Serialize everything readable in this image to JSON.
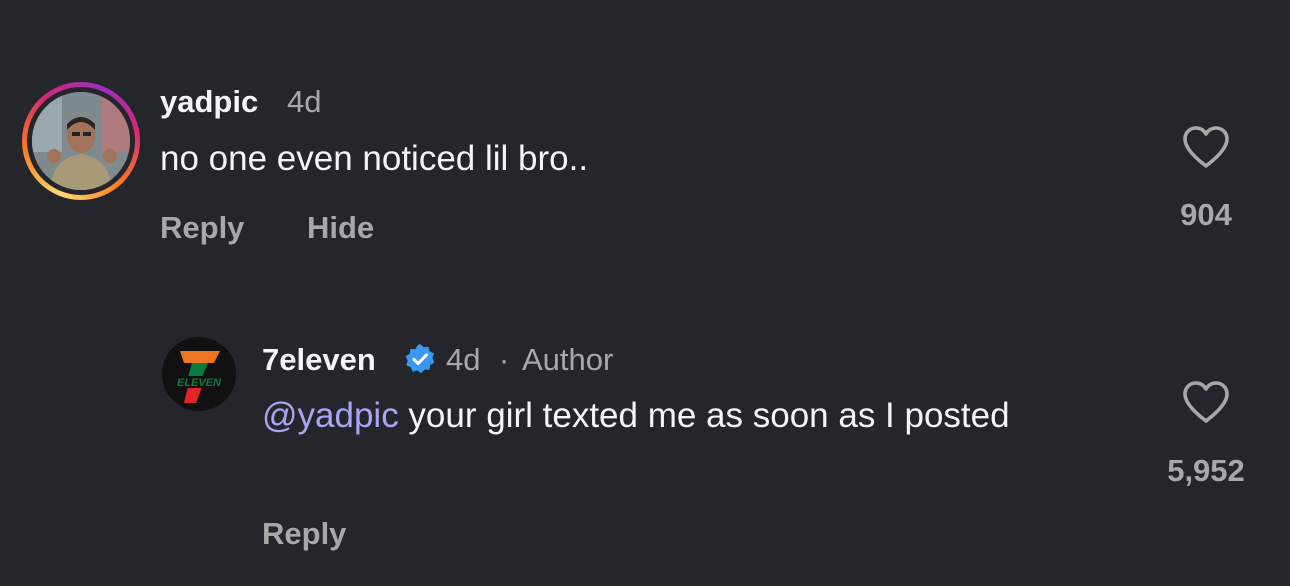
{
  "comments": [
    {
      "username": "yadpic",
      "time": "4d",
      "text": "no one even noticed lil bro..",
      "actions": {
        "reply": "Reply",
        "hide": "Hide"
      },
      "likes": "904"
    }
  ],
  "reply": {
    "username": "7eleven",
    "time": "4d",
    "separator": "·",
    "author_badge": "Author",
    "mention": "@yadpic",
    "text": " your girl texted me as soon as I posted",
    "actions": {
      "reply": "Reply"
    },
    "likes": "5,952",
    "logo_text": "ELEVEN"
  },
  "icons": {
    "like": "heart-outline-icon",
    "verified": "verified-badge-icon"
  },
  "colors": {
    "background": "#25262b",
    "mention": "#a7a6f5",
    "secondary_text": "#a8a8a8",
    "verified": "#3897f0"
  }
}
